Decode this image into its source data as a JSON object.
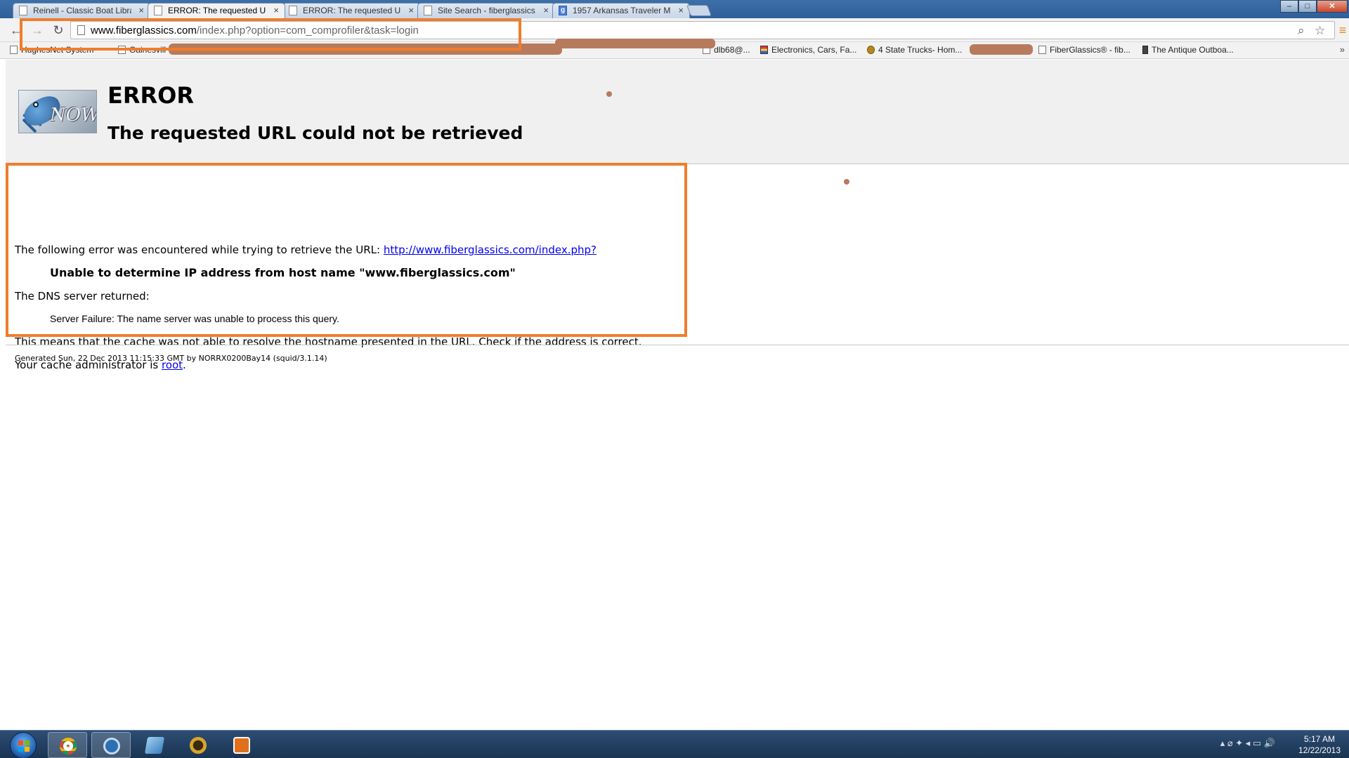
{
  "browser": {
    "tabs": [
      {
        "title": "Reinell - Classic Boat Libra",
        "active": false,
        "favicon": "page-icon"
      },
      {
        "title": "ERROR: The requested URL",
        "active": true,
        "favicon": "page-icon"
      },
      {
        "title": "ERROR: The requested URL",
        "active": false,
        "favicon": "page-icon"
      },
      {
        "title": "Site Search - fiberglassics",
        "active": false,
        "favicon": "page-icon"
      },
      {
        "title": "1957 Arkansas Traveler M",
        "active": false,
        "favicon": "google-icon"
      }
    ],
    "tab_close_glyph": "×",
    "window_controls": {
      "minimize": "–",
      "maximize": "□",
      "close": "✕"
    },
    "nav": {
      "back": "←",
      "forward": "→",
      "reload": "↻"
    },
    "address": {
      "host": "www.fiberglassics.com",
      "path": "/index.php?option=com_comprofiler&task=login"
    },
    "omnibox_icons": {
      "search": "⌕",
      "star": "☆",
      "menu": "≡"
    },
    "bookmarks": [
      {
        "label": "HughesNet System",
        "icon": "page-icon"
      },
      {
        "label": "Gainesvill",
        "icon": "page-icon"
      },
      {
        "label": "dlb68@...",
        "icon": "page-icon"
      },
      {
        "label": "Electronics, Cars, Fa...",
        "icon": "ebay-icon"
      },
      {
        "label": "4 State Trucks- Hom...",
        "icon": "truck-icon"
      },
      {
        "label": "FiberGlassics® - fib...",
        "icon": "page-icon"
      },
      {
        "label": "The Antique Outboa...",
        "icon": "outboard-icon"
      }
    ],
    "bookmarks_overflow": "»"
  },
  "page": {
    "logo_text": "NOW",
    "title": "ERROR",
    "subtitle": "The requested URL could not be retrieved",
    "intro_text": "The following error was encountered while trying to retrieve the URL: ",
    "url_link": "http://www.fiberglassics.com/index.php?",
    "error_message": "Unable to determine IP address from host name \"www.fiberglassics.com\"",
    "dns_label": "The DNS server returned:",
    "dns_message": "Server Failure: The name server was unable to process this query.",
    "explanation": "This means that the cache was not able to resolve the hostname presented in the URL. Check if the address is correct.",
    "admin_prefix": "Your cache administrator is ",
    "admin_link": "root",
    "admin_suffix": ".",
    "footer": "Generated Sun, 22 Dec 2013 11:15:33 GMT by NORRX0200Bay14 (squid/3.1.14)"
  },
  "taskbar": {
    "apps": [
      {
        "name": "chrome",
        "active": true
      },
      {
        "name": "app-2",
        "active": true
      },
      {
        "name": "notepad",
        "active": false
      },
      {
        "name": "world-of-warcraft",
        "active": false
      },
      {
        "name": "media-player",
        "active": false
      }
    ],
    "tray_glyphs": "▴  ⌀  ✦  ◂  ▭  🔊",
    "time": "5:17 AM",
    "date": "12/22/2013"
  },
  "colors": {
    "annotation": "#f07d2b",
    "redaction": "#b87a5c",
    "link": "#0000ee"
  }
}
